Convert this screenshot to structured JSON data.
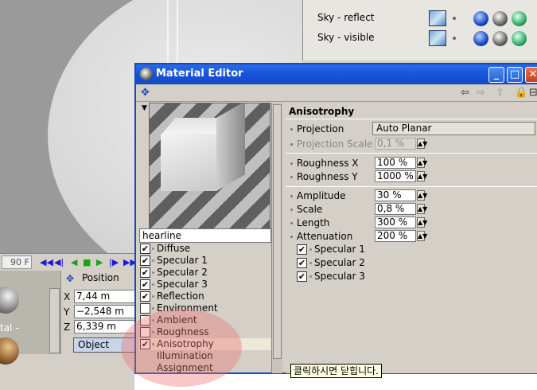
{
  "window": {
    "title": "Material Editor",
    "minimize_label": "_",
    "maximize_label": "□",
    "close_label": "✕"
  },
  "object_manager": {
    "items": [
      {
        "name": "Sky - reflect"
      },
      {
        "name": "Sky - visible"
      }
    ]
  },
  "timeline": {
    "frame": "90 F",
    "controls": [
      "◀◀",
      "◀|",
      "◀",
      "■",
      "▶",
      "|▶",
      "▶▶"
    ]
  },
  "materials_panel": {
    "label": "tal -"
  },
  "coordinates": {
    "title": "Position",
    "x_axis": "X",
    "x": "7,44 m",
    "y_axis": "Y",
    "y": "−2,548 m",
    "z_axis": "Z",
    "z": "6,339 m",
    "mode": "Object"
  },
  "material": {
    "name": "hearline",
    "channels": [
      {
        "label": "Diffuse",
        "checked": true,
        "icon": "check-icon"
      },
      {
        "label": "Specular 1",
        "checked": true,
        "icon": "check-icon"
      },
      {
        "label": "Specular 2",
        "checked": true,
        "icon": "check-icon"
      },
      {
        "label": "Specular 3",
        "checked": true,
        "icon": "check-icon"
      },
      {
        "label": "Reflection",
        "checked": true,
        "icon": "check-icon"
      },
      {
        "label": "Environment",
        "checked": false,
        "icon": "checkbox-icon"
      },
      {
        "label": "Ambient",
        "checked": false,
        "icon": "checkbox-icon"
      },
      {
        "label": "Roughness",
        "checked": false,
        "icon": "checkbox-icon"
      },
      {
        "label": "Anisotrophy",
        "checked": true,
        "icon": "check-icon"
      },
      {
        "label": "Illumination",
        "checked": null,
        "icon": ""
      },
      {
        "label": "Assignment",
        "checked": null,
        "icon": ""
      }
    ]
  },
  "attributes": {
    "header": "Anisotrophy",
    "projection_label": "Projection",
    "projection_value": "Auto Planar",
    "projection_scale_label": "Projection Scale",
    "projection_scale_value": "0,1 %",
    "roughness_x_label": "Roughness X",
    "roughness_x_value": "100 %",
    "roughness_y_label": "Roughness Y",
    "roughness_y_value": "1000 %",
    "amplitude_label": "Amplitude",
    "amplitude_value": "30 %",
    "scale_label": "Scale",
    "scale_value": "0,8 %",
    "length_label": "Length",
    "length_value": "300 %",
    "attenuation_label": "Attenuation",
    "attenuation_value": "200 %",
    "specular_1_label": "Specular 1",
    "specular_2_label": "Specular 2",
    "specular_3_label": "Specular 3"
  },
  "tooltip": {
    "text": "클릭하시면 닫힙니다."
  },
  "colors": {
    "titlebar": "#1550d6",
    "window_bg": "#d4d0c8",
    "highlight": "#ec6e6e"
  }
}
